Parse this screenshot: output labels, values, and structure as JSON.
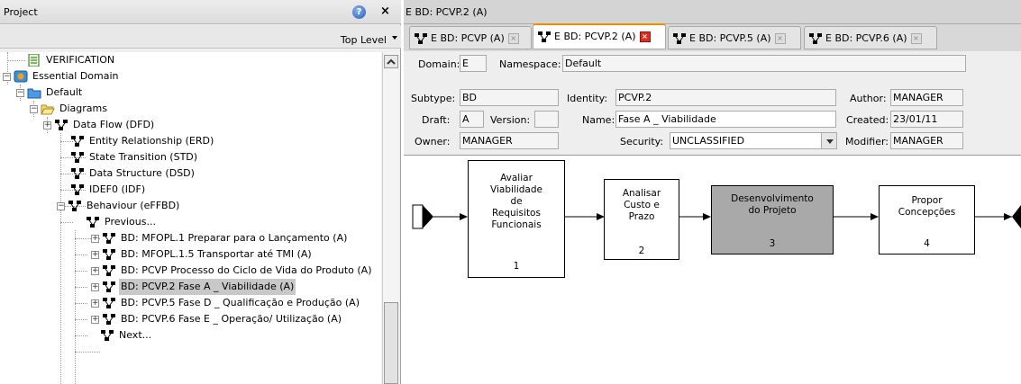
{
  "project_panel": {
    "title": "Project",
    "help_icon": "help-icon",
    "close_label": "×",
    "top_level_label": "Top Level"
  },
  "tree": {
    "items": [
      {
        "label": "VERIFICATION",
        "icon": "document-icon"
      },
      {
        "label": "Essential Domain",
        "icon": "domain-icon"
      },
      {
        "label": "Default",
        "icon": "folder-icon"
      },
      {
        "label": "Diagrams",
        "icon": "folder-open-icon"
      },
      {
        "label": "Data Flow (DFD)",
        "icon": "diagram-icon"
      },
      {
        "label": "Entity Relationship (ERD)",
        "icon": "diagram-icon"
      },
      {
        "label": "State Transition (STD)",
        "icon": "diagram-icon"
      },
      {
        "label": "Data Structure (DSD)",
        "icon": "diagram-icon"
      },
      {
        "label": "IDEF0 (IDF)",
        "icon": "diagram-icon"
      },
      {
        "label": "Behaviour (eFFBD)",
        "icon": "diagram-icon"
      },
      {
        "label": "Previous...",
        "icon": "diagram-icon"
      },
      {
        "label": "BD: MFOPL.1 Preparar para o Lançamento (A)",
        "icon": "diagram-icon"
      },
      {
        "label": "BD: MFOPL.1.5 Transportar até TMI (A)",
        "icon": "diagram-icon"
      },
      {
        "label": "BD: PCVP Processo do Ciclo de Vida do Produto (A)",
        "icon": "diagram-icon"
      },
      {
        "label": "BD: PCVP.2 Fase A _ Viabilidade (A)",
        "icon": "diagram-icon",
        "selected": true
      },
      {
        "label": "BD: PCVP.5 Fase D _ Qualificação e Produção (A)",
        "icon": "diagram-icon"
      },
      {
        "label": "BD: PCVP.6 Fase E _ Operação/ Utilização (A)",
        "icon": "diagram-icon"
      },
      {
        "label": "Next...",
        "icon": "diagram-icon"
      }
    ]
  },
  "editor": {
    "title": "E BD: PCVP.2 (A)",
    "tabs": [
      {
        "label": "E BD: PCVP (A)"
      },
      {
        "label": "E BD: PCVP.2 (A)",
        "active": true
      },
      {
        "label": "E BD: PCVP.5 (A)"
      },
      {
        "label": "E BD: PCVP.6 (A)"
      }
    ]
  },
  "properties": {
    "domain_label": "Domain:",
    "domain_value": "E",
    "namespace_label": "Namespace:",
    "namespace_value": "Default",
    "subtype_label": "Subtype:",
    "subtype_value": "BD",
    "identity_label": "Identity:",
    "identity_value": "PCVP.2",
    "author_label": "Author:",
    "author_value": "MANAGER",
    "draft_label": "Draft:",
    "draft_value": "A",
    "version_label": "Version:",
    "version_value": "",
    "name_label": "Name:",
    "name_value": "Fase A _ Viabilidade",
    "created_label": "Created:",
    "created_value": "23/01/11",
    "owner_label": "Owner:",
    "owner_value": "MANAGER",
    "security_label": "Security:",
    "security_value": "UNCLASSIFIED",
    "modifier_label": "Modifier:",
    "modifier_value": "MANAGER"
  },
  "diagram": {
    "blocks": [
      {
        "l1": "Avaliar",
        "l2": "Viabilidade",
        "l3": "de",
        "l4": "Requisitos",
        "l5": "Funcionais",
        "num": "1",
        "highlighted": false
      },
      {
        "l1": "Analisar",
        "l2": "Custo e",
        "l3": "Prazo",
        "num": "2",
        "highlighted": false
      },
      {
        "l1": "Desenvolvimento",
        "l2": "do Projeto",
        "num": "3",
        "highlighted": true
      },
      {
        "l1": "Propor",
        "l2": "Concepções",
        "num": "4",
        "highlighted": false
      }
    ]
  },
  "colors": {
    "active_tab_accent": "#f08c00",
    "highlighted_block": "#a9a9a9",
    "selected_row": "#c8c8c8"
  }
}
